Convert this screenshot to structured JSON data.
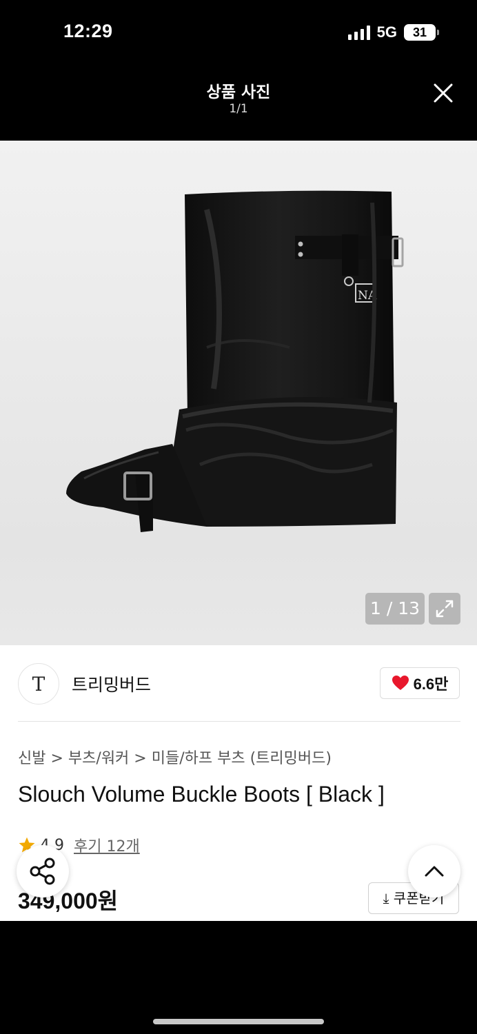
{
  "status_bar": {
    "time": "12:29",
    "network": "5G",
    "battery": "31"
  },
  "viewer": {
    "title": "상품 사진",
    "counter": "1/1"
  },
  "photo": {
    "counter": "1 / 13",
    "boot_tag": "NA"
  },
  "brand": {
    "logo_letter": "T",
    "name": "트리밍버드",
    "likes": "6.6만"
  },
  "breadcrumb": [
    "신발",
    "부츠/워커",
    "미들/하프 부츠 (트리밍버드)"
  ],
  "breadcrumb_separator": ">",
  "product": {
    "title": "Slouch Volume Buckle Boots [ Black ]",
    "rating": "4.9",
    "reviews": "후기 12개",
    "price": "349,000원",
    "coupon_label": "⤓ 쿠폰받기"
  },
  "colors": {
    "heart": "#e8172c",
    "star": "#f2a900",
    "chrome": "#000000"
  }
}
